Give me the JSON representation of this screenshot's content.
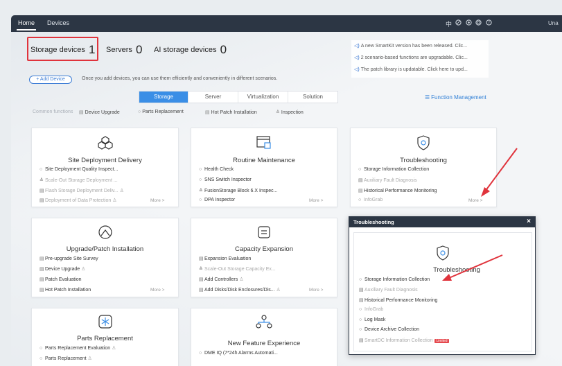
{
  "nav": {
    "home": "Home",
    "devices": "Devices",
    "icons": [
      "language-icon",
      "help-ring-icon",
      "settings-icon",
      "alert-icon",
      "question-icon"
    ],
    "user": "Una"
  },
  "stats": {
    "storage_label": "Storage devices",
    "storage_count": "1",
    "servers_label": "Servers",
    "servers_count": "0",
    "ai_label": "AI storage devices",
    "ai_count": "0"
  },
  "add_device": {
    "label": "+ Add Device",
    "hint": "Once you add devices, you can use them efficiently and conveniently in different scenarios."
  },
  "notices": [
    "A new SmartKit version has been released. Clic...",
    "2 scenario-based functions are upgradable. Clic...",
    "The patch library is updatable. Click here to upd..."
  ],
  "tabs": [
    "Storage",
    "Server",
    "Virtualization",
    "Solution"
  ],
  "active_tab": "Storage",
  "function_management": "Function Management",
  "common_functions": {
    "label": "Common functions",
    "items": [
      "Device Upgrade",
      "Parts Replacement",
      "Hot Patch Installation",
      "Inspection"
    ]
  },
  "cards": {
    "site": {
      "title": "Site Deployment Delivery",
      "items": [
        "Site Deployment Quality Inspect...",
        "Scale-Out Storage Deployment ...",
        "Flash Storage Deployment Deliv...",
        "Deployment of Data Protection"
      ],
      "more": "More >"
    },
    "routine": {
      "title": "Routine Maintenance",
      "items": [
        "Health Check",
        "SNS Switch Inspector",
        "FusionStorage Block 6.X Inspec...",
        "DPA Inspector"
      ],
      "more": "More >"
    },
    "trouble": {
      "title": "Troubleshooting",
      "items": [
        "Storage Information Collection",
        "Auxiliary Fault Diagnosis",
        "Historical Performance Monitoring",
        "InfoGrab"
      ],
      "more": "More >"
    },
    "upgrade": {
      "title": "Upgrade/Patch Installation",
      "items": [
        "Pre-upgrade Site Survey",
        "Device Upgrade",
        "Patch Evaluation",
        "Hot Patch Installation"
      ],
      "more": "More >"
    },
    "capacity": {
      "title": "Capacity Expansion",
      "items": [
        "Expansion Evaluation",
        "Scale-Out Storage Capacity Ex...",
        "Add Controllers",
        "Add Disks/Disk Enclosures/Dis..."
      ],
      "more": "More >"
    },
    "parts": {
      "title": "Parts Replacement",
      "items": [
        "Parts Replacement Evaluation",
        "Parts Replacement"
      ]
    },
    "newfeature": {
      "title": "New Feature Experience",
      "items": [
        "DME IQ (7*24h Alarms Automati..."
      ]
    }
  },
  "popup": {
    "header": "Troubleshooting",
    "close": "×",
    "title": "Troubleshooting",
    "items": [
      "Storage Information Collection",
      "Auxiliary Fault Diagnosis",
      "Historical Performance Monitoring",
      "InfoGrab",
      "Log Mask",
      "Device Archive Collection",
      "SmartDC Information Collection"
    ],
    "tag": "Limited"
  },
  "colors": {
    "nav_bg": "#2c3644",
    "accent": "#3a8ee6",
    "highlight": "#e0333c"
  }
}
